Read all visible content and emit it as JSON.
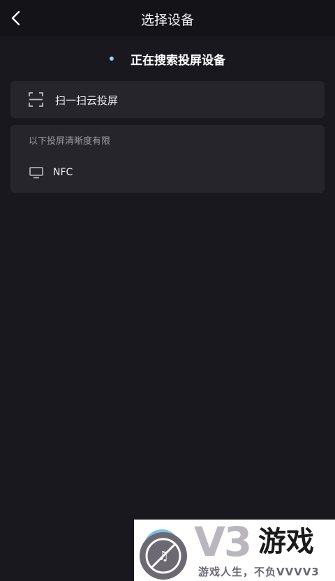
{
  "header": {
    "title": "选择设备",
    "back_icon": "chevron-left-icon"
  },
  "status": {
    "searching_text": "正在搜索投屏设备"
  },
  "scan_card": {
    "icon": "scan-frame-icon",
    "label": "扫一扫云投屏"
  },
  "devices_card": {
    "header": "以下投屏清晰度有限",
    "devices": [
      {
        "icon": "tv-monitor-icon",
        "name": "NFC"
      }
    ]
  },
  "watermark": {
    "mark": "V3",
    "brand": "游戏",
    "slogan": "游戏人生，不负VVVV3"
  },
  "colors": {
    "background": "#19181e",
    "card": "#26252c",
    "accent_dot": "#5a9cd0"
  }
}
